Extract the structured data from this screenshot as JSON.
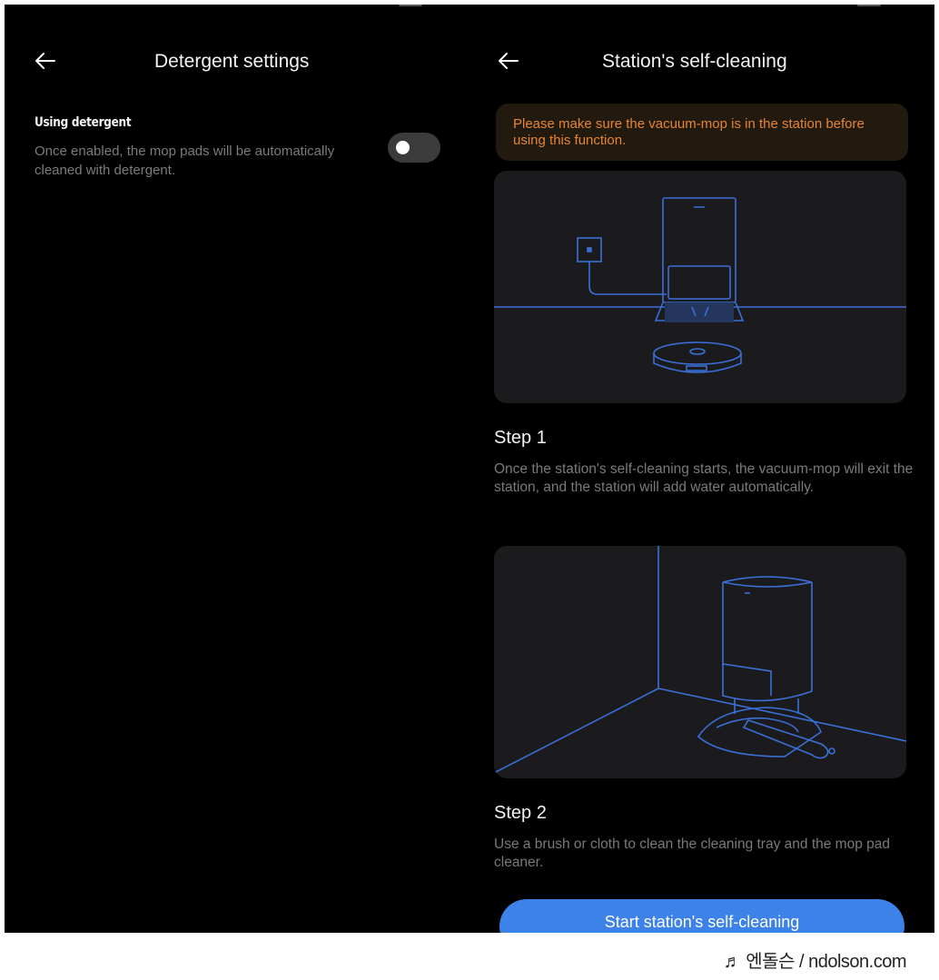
{
  "left_screen": {
    "title": "Detergent settings",
    "setting": {
      "label": "Using detergent",
      "description": "Once enabled, the mop pads will be automatically cleaned with detergent.",
      "toggle_state": "off"
    }
  },
  "right_screen": {
    "title": "Station's self-cleaning",
    "warning": "Please make sure the vacuum-mop is in the station before using this function.",
    "steps": [
      {
        "title": "Step 1",
        "description": "Once the station's self-cleaning starts, the vacuum-mop will exit the station, and the station will add water automatically."
      },
      {
        "title": "Step 2",
        "description": " Use a brush or cloth to clean the cleaning tray and the mop pad cleaner."
      }
    ],
    "start_button": "Start station's self-cleaning"
  },
  "watermark": "♬ 엔돌슨 / ndolson.com",
  "colors": {
    "background": "#000000",
    "accent_blue": "#3d82e8",
    "warning_text": "#e6852f",
    "warning_bg": "#231a0f",
    "illustration_line": "#3a6fd8"
  }
}
